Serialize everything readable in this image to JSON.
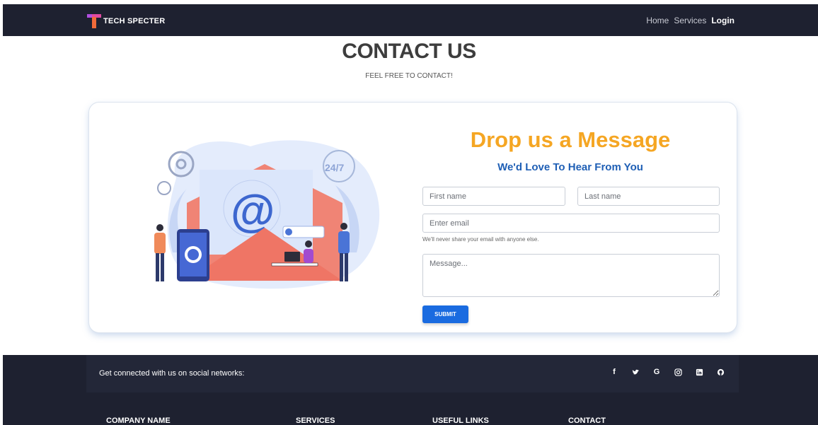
{
  "navbar": {
    "brand": "TECH SPECTER",
    "links": [
      "Home",
      "Services",
      "Login"
    ]
  },
  "header": {
    "title": "CONTACT US",
    "subtitle": "FEEL FREE TO CONTACT!"
  },
  "form": {
    "title": "Drop us a Message",
    "subtitle": "We'd Love To Hear From You",
    "first_name_placeholder": "First name",
    "last_name_placeholder": "Last name",
    "email_placeholder": "Enter email",
    "email_help": "We'll never share your email with anyone else.",
    "message_placeholder": "Message...",
    "submit_label": "SUBMIT"
  },
  "illustration": {
    "badge": "24/7",
    "symbol": "@"
  },
  "footer": {
    "social_text": "Get connected with us on social networks:",
    "social_icons": [
      "facebook-icon",
      "twitter-icon",
      "google-icon",
      "instagram-icon",
      "linkedin-icon",
      "github-icon"
    ],
    "columns": [
      "COMPANY NAME",
      "SERVICES",
      "USEFUL LINKS",
      "CONTACT"
    ]
  },
  "colors": {
    "navbar_bg": "#1e2130",
    "accent_orange": "#f5a623",
    "accent_blue": "#1f5fb5",
    "button_blue": "#1a6be0"
  }
}
